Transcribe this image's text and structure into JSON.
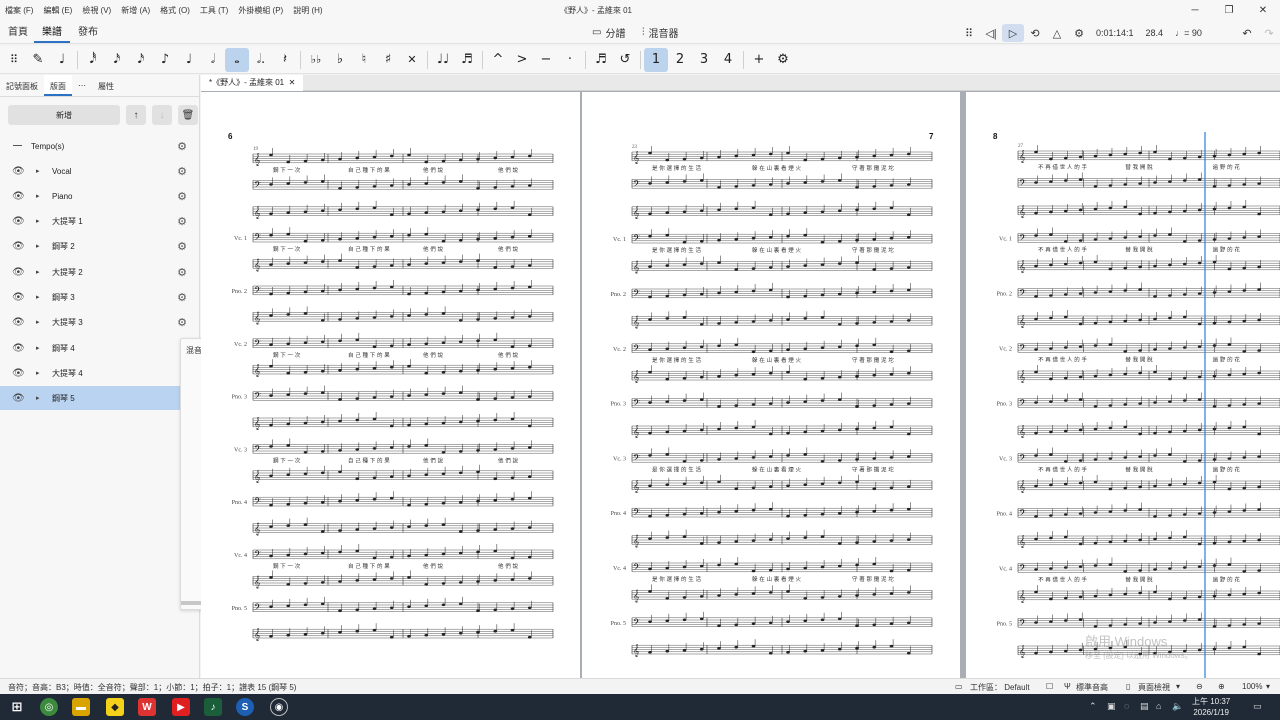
{
  "menu": [
    "檔案 (F)",
    "編輯 (E)",
    "檢視 (V)",
    "新增 (A)",
    "格式 (O)",
    "工具 (T)",
    "外掛模組 (P)",
    "說明 (H)"
  ],
  "window_title": "《野人》- 孟維來 01",
  "window_controls": {
    "minimize": "─",
    "maximize": "❐",
    "close": "✕"
  },
  "workspace_tabs": [
    "首頁",
    "樂譜",
    "發布"
  ],
  "center_tools": {
    "parts": "分譜",
    "mixer": "混音器"
  },
  "playback": {
    "position": "0:01:14:1",
    "measure_beat": "28.4",
    "tempo": "♩= 90"
  },
  "note_toolbar": [
    "✎",
    "♪",
    "𝅘𝅥𝅰",
    "𝅘𝅥𝅯",
    "♪",
    "♩",
    "𝅗𝅥",
    "𝅝",
    "·",
    "𝄽",
    "♭♭",
    "♭",
    "♮",
    "♯",
    "𝄪",
    "♫",
    "♬",
    "^",
    ">",
    "−",
    "·",
    "♬",
    "⌒",
    "1",
    "2",
    "3",
    "4",
    "+",
    "⚙"
  ],
  "left_panel": {
    "tabs": [
      "記號面板",
      "版面",
      "屬性"
    ],
    "new_button": "新增",
    "instruments": [
      {
        "name": "Tempo(s)",
        "type": "tempo"
      },
      {
        "name": "Vocal"
      },
      {
        "name": "Piano"
      },
      {
        "name": "大提琴 1"
      },
      {
        "name": "鋼琴 2"
      },
      {
        "name": "大提琴 2"
      },
      {
        "name": "鋼琴 3"
      },
      {
        "name": "大提琴 3"
      },
      {
        "name": "鋼琴 4"
      },
      {
        "name": "大提琴 4"
      },
      {
        "name": "鋼琴 5",
        "selected": true
      }
    ],
    "mixer_popup_label": "混音器"
  },
  "document_tab": "*《野人》- 孟維來 01",
  "pages": [
    {
      "number": "6",
      "measure_start": "19",
      "staff_labels": [
        "",
        "",
        "",
        "Vc. 1",
        "",
        "Pno. 2",
        "",
        "Vc. 2",
        "",
        "Pno. 3",
        "",
        "Vc. 3",
        "",
        "Pno. 4",
        "",
        "Vc. 4",
        "",
        "Pno. 5",
        ""
      ],
      "lyrics": [
        "鋼 下 一 次",
        "自 己 種 下 的 果",
        "他 們 說",
        "他 們 說"
      ]
    },
    {
      "number": "7",
      "measure_start": "23",
      "staff_labels": [
        "",
        "",
        "",
        "Vc. 1",
        "",
        "Pno. 2",
        "",
        "Vc. 2",
        "",
        "Pno. 3",
        "",
        "Vc. 3",
        "",
        "Pno. 4",
        "",
        "Vc. 4",
        "",
        "Pno. 5",
        ""
      ],
      "lyrics": [
        "是 你 選 擇 的 生 活",
        "躲 在 山 裏 看 煙 火",
        "守 著 那 攤 泥 坨"
      ]
    },
    {
      "number": "8",
      "measure_start": "27",
      "staff_labels": [
        "",
        "",
        "",
        "Vc. 1",
        "",
        "Pno. 2",
        "",
        "Vc. 2",
        "",
        "Pno. 3",
        "",
        "Vc. 3",
        "",
        "Pno. 4",
        "",
        "Vc. 4",
        "",
        "Pno. 5",
        ""
      ],
      "lyrics": [
        "不 再 借 世 人 的 手",
        "替 我 開 脫",
        "遍 野 的 花"
      ]
    }
  ],
  "watermark": {
    "line1": "啟用 Windows",
    "line2": "移至 [設定] 以啟用 Windows。"
  },
  "status": {
    "text": "音符；音高：B3；時值：全音符；聲部：1；小節：1；拍子：1；譜表 15 (鋼琴 5)",
    "workspace": "工作區： Default",
    "concert_pitch": "標準音高",
    "page_view": "頁面檢視",
    "zoom": "100%"
  },
  "taskbar": {
    "time": "上午 10:37",
    "date": "2026/1/19"
  }
}
